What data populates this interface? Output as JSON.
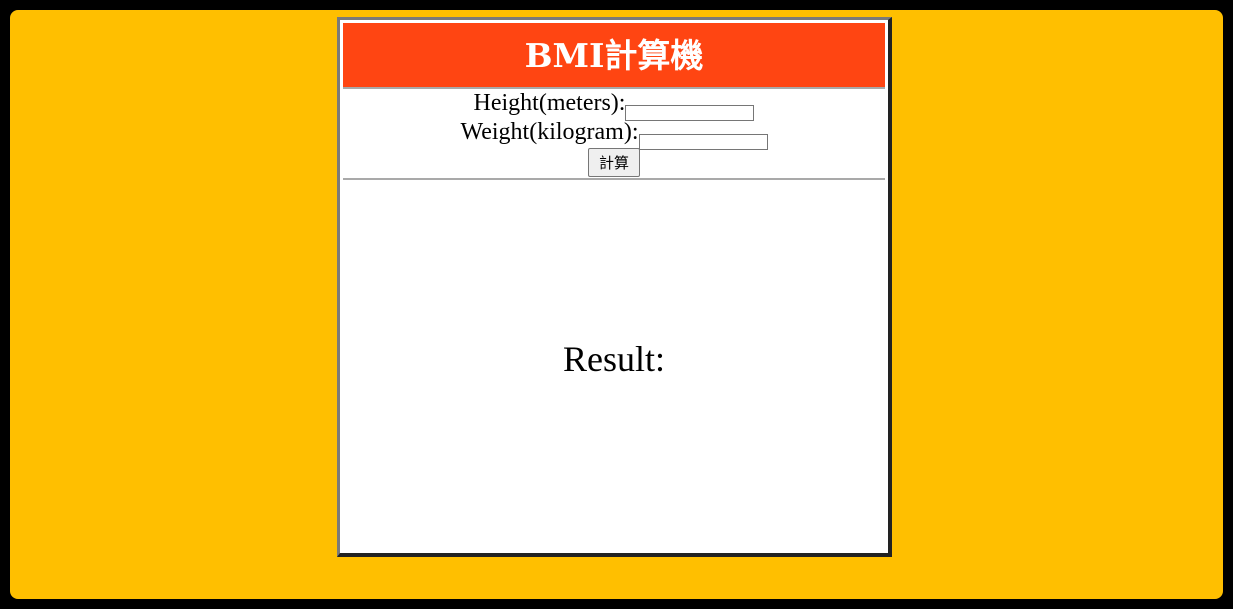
{
  "colors": {
    "background": "#FFBF00",
    "header": "#FF4512"
  },
  "app": {
    "title": "BMI計算機"
  },
  "form": {
    "height_label": "Height(meters):",
    "height_value": "",
    "weight_label": "Weight(kilogram):",
    "weight_value": "",
    "calculate_label": "計算"
  },
  "result": {
    "label": "Result:"
  }
}
